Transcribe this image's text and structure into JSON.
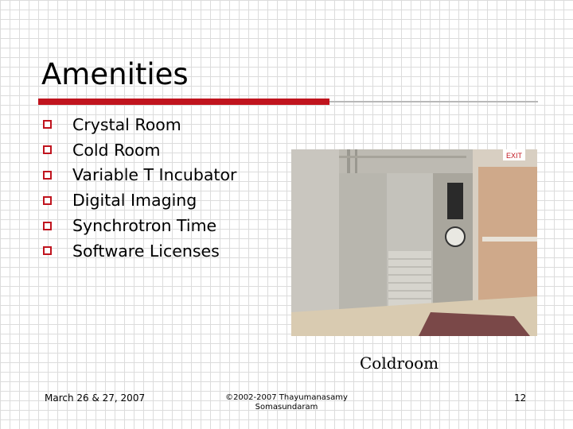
{
  "slide": {
    "title": "Amenities",
    "bullets": [
      "Crystal Room",
      "Cold Room",
      "Variable T Incubator",
      "Digital Imaging",
      "Synchrotron Time",
      "Software Licenses"
    ],
    "image": {
      "caption": "Coldroom",
      "exit_sign": "EXIT"
    },
    "footer": {
      "date": "March 26 & 27, 2007",
      "copyright_line1": "©2002-2007 Thayumanasamy",
      "copyright_line2": "Somasundaram",
      "page_number": "12"
    }
  },
  "colors": {
    "accent": "#c0141e",
    "divider": "#b8b8b8"
  }
}
